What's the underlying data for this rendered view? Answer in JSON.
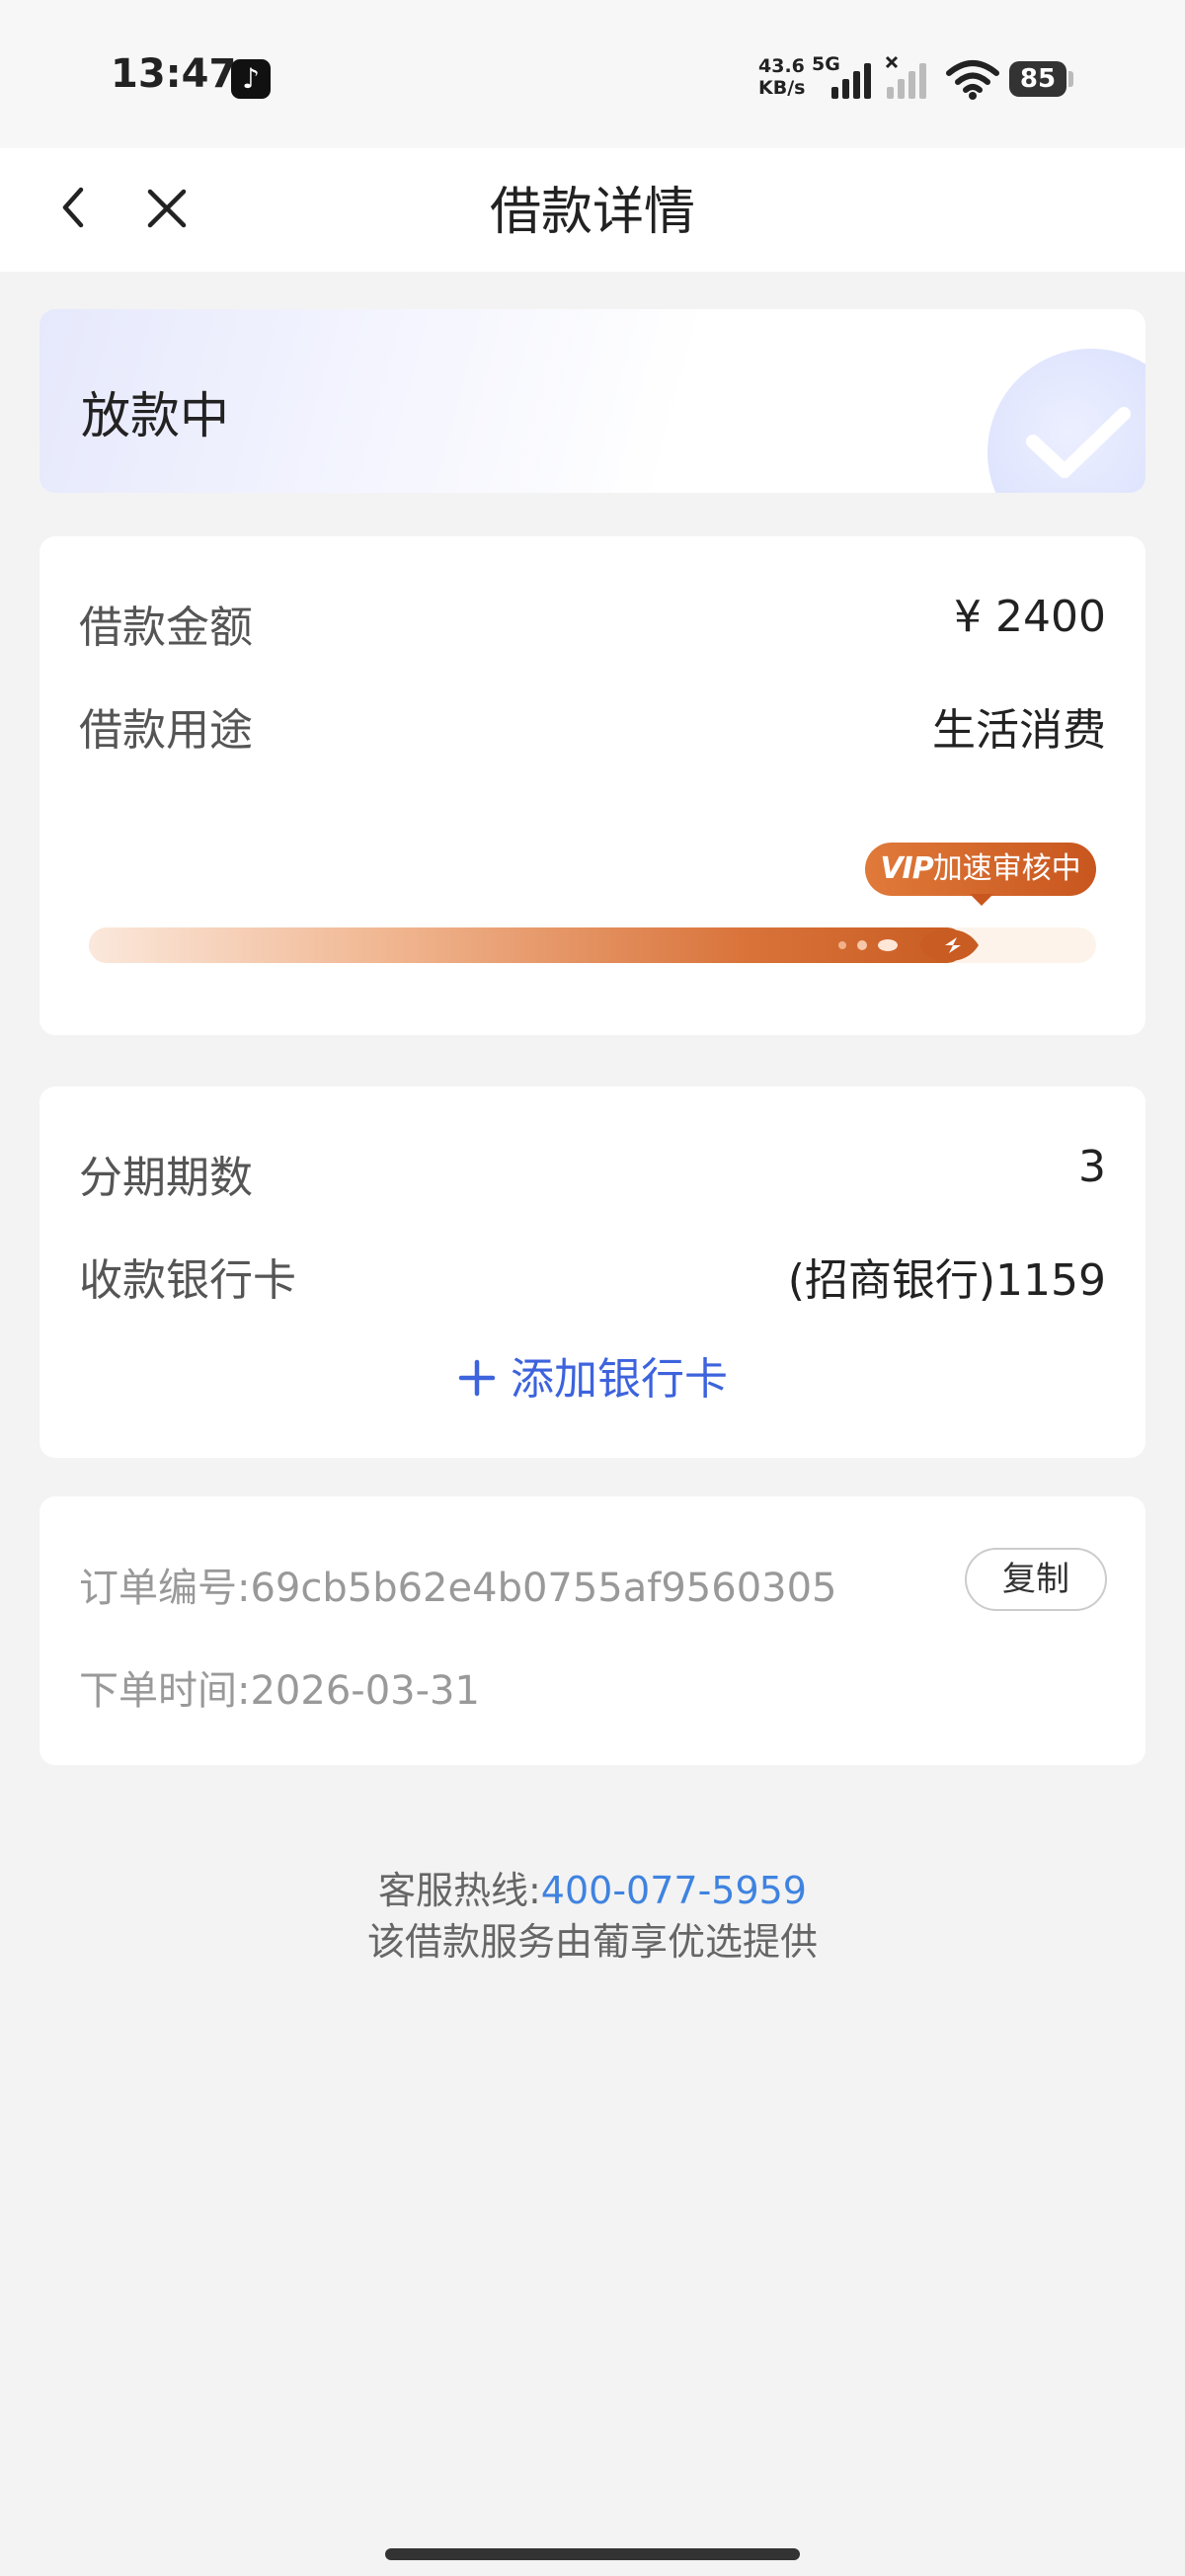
{
  "status_bar": {
    "time": "13:47",
    "net_speed_value": "43.6",
    "net_speed_unit": "KB/s",
    "network": "5G",
    "battery": "85"
  },
  "navbar": {
    "title": "借款详情"
  },
  "loan_status": {
    "text": "放款中"
  },
  "loan_info": {
    "amount_label": "借款金额",
    "amount_value": "¥ 2400",
    "purpose_label": "借款用途",
    "purpose_value": "生活消费",
    "vip_badge": "VIP",
    "vip_status": "加速审核中",
    "progress": 0.87
  },
  "repayment": {
    "installments_label": "分期期数",
    "installments_value": "3",
    "bank_label": "收款银行卡",
    "bank_value": "(招商银行)1159",
    "add_bank_label": "添加银行卡"
  },
  "order": {
    "order_no_label": "订单编号:",
    "order_no": "69cb5b62e4b0755af9560305",
    "copy_label": "复制",
    "order_time_label": "下单时间:",
    "order_time": "2026-03-31"
  },
  "footer": {
    "hotline_label": "客服热线:",
    "hotline_number": "400-077-5959",
    "provider_text": "该借款服务由葡享优选提供"
  }
}
